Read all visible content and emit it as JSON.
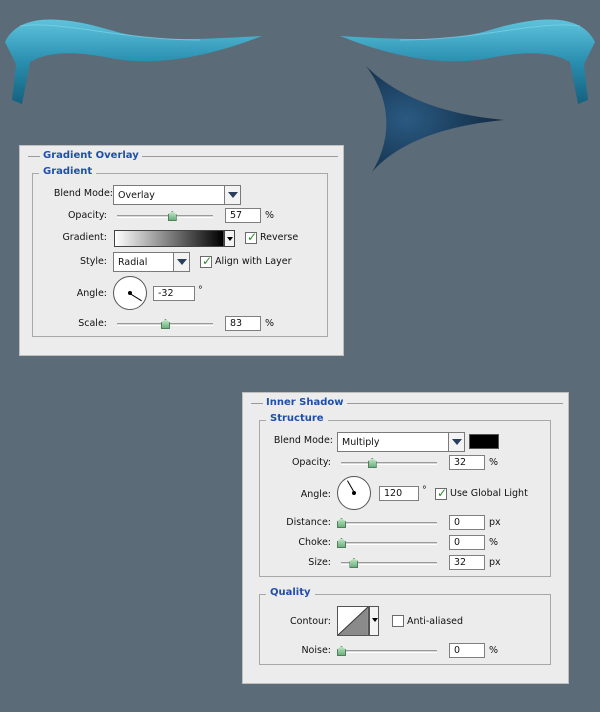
{
  "colors": {
    "background": "#5b6b78",
    "panel": "#ececec",
    "title_blue": "#1f4fa8",
    "ribbon": "#2a8fb0",
    "arrow": "#15304a"
  },
  "icons": {
    "ribbon_left": "ribbon-decoration",
    "ribbon_right": "ribbon-decoration",
    "arrow": "curved-arrow-shape"
  },
  "gradient_overlay": {
    "title": "Gradient Overlay",
    "group_title": "Gradient",
    "blend_mode_label": "Blend Mode:",
    "blend_mode_value": "Overlay",
    "opacity_label": "Opacity:",
    "opacity_value": "57",
    "opacity_unit": "%",
    "opacity_slider_fraction": 0.57,
    "gradient_label": "Gradient:",
    "reverse_label": "Reverse",
    "reverse_checked": true,
    "style_label": "Style:",
    "style_value": "Radial",
    "align_label": "Align with Layer",
    "align_checked": true,
    "angle_label": "Angle:",
    "angle_value": "-32",
    "angle_unit": "°",
    "scale_label": "Scale:",
    "scale_value": "83",
    "scale_unit": "%",
    "scale_slider_fraction": 0.5
  },
  "inner_shadow": {
    "title": "Inner Shadow",
    "structure_title": "Structure",
    "blend_mode_label": "Blend Mode:",
    "blend_mode_value": "Multiply",
    "opacity_label": "Opacity:",
    "opacity_value": "32",
    "opacity_unit": "%",
    "opacity_slider_fraction": 0.32,
    "angle_label": "Angle:",
    "angle_value": "120",
    "angle_unit": "°",
    "global_light_label": "Use Global Light",
    "global_light_checked": true,
    "distance_label": "Distance:",
    "distance_value": "0",
    "distance_unit": "px",
    "distance_slider_fraction": 0,
    "choke_label": "Choke:",
    "choke_value": "0",
    "choke_unit": "%",
    "choke_slider_fraction": 0,
    "size_label": "Size:",
    "size_value": "32",
    "size_unit": "px",
    "size_slider_fraction": 0.13,
    "quality_title": "Quality",
    "contour_label": "Contour:",
    "anti_aliased_label": "Anti-aliased",
    "anti_aliased_checked": false,
    "noise_label": "Noise:",
    "noise_value": "0",
    "noise_unit": "%",
    "noise_slider_fraction": 0
  }
}
